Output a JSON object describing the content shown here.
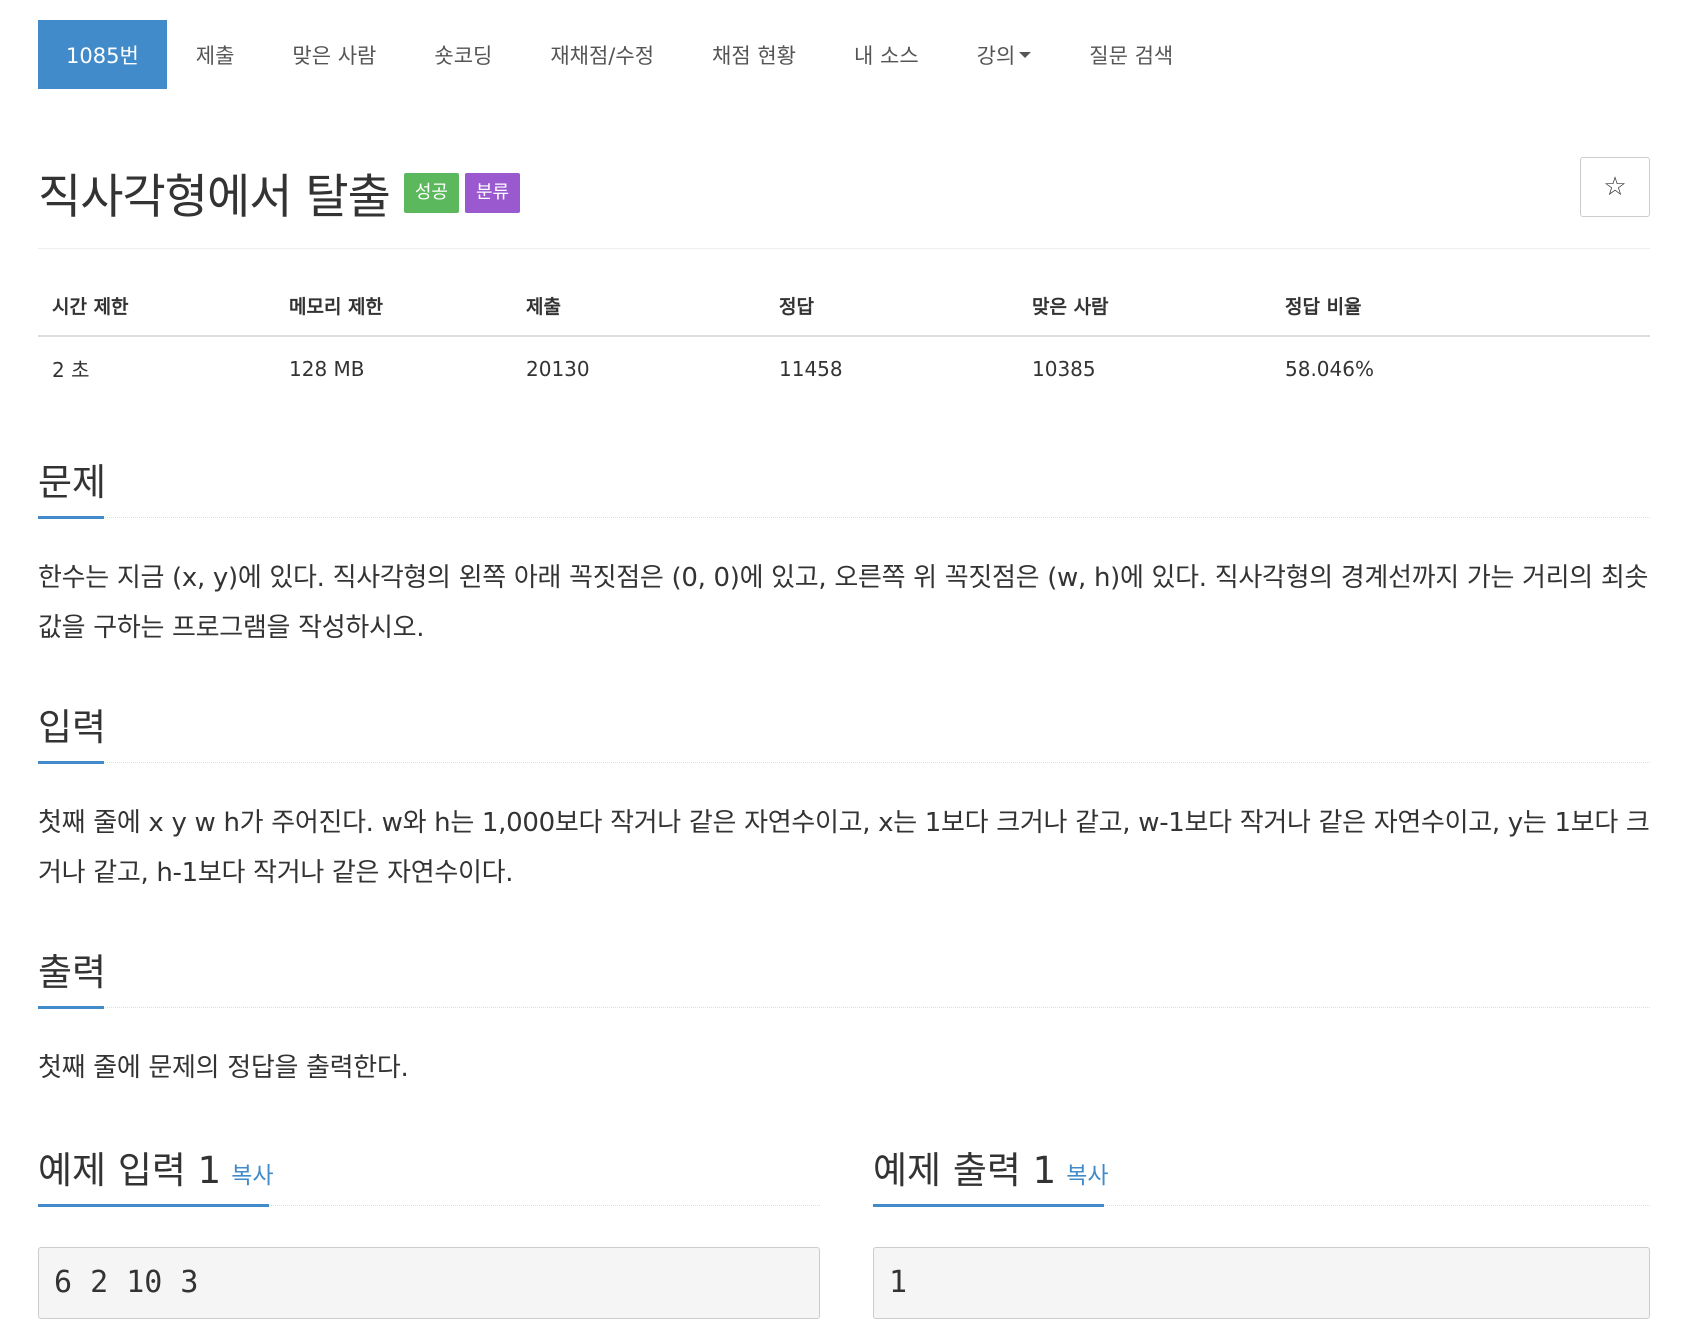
{
  "nav": {
    "items": [
      {
        "label": "1085번",
        "active": true
      },
      {
        "label": "제출"
      },
      {
        "label": "맞은 사람"
      },
      {
        "label": "숏코딩"
      },
      {
        "label": "재채점/수정"
      },
      {
        "label": "채점 현황"
      },
      {
        "label": "내 소스"
      },
      {
        "label": "강의",
        "dropdown": true
      },
      {
        "label": "질문 검색"
      }
    ]
  },
  "problem": {
    "title": "직사각형에서 탈출",
    "badge_success": "성공",
    "badge_tag": "분류",
    "star": "☆"
  },
  "info": {
    "headers": [
      "시간 제한",
      "메모리 제한",
      "제출",
      "정답",
      "맞은 사람",
      "정답 비율"
    ],
    "values": [
      "2 초",
      "128 MB",
      "20130",
      "11458",
      "10385",
      "58.046%"
    ]
  },
  "sections": {
    "description": {
      "title": "문제",
      "text": "한수는 지금 (x, y)에 있다. 직사각형의 왼쪽 아래 꼭짓점은 (0, 0)에 있고, 오른쪽 위 꼭짓점은 (w, h)에 있다. 직사각형의 경계선까지 가는 거리의 최솟값을 구하는 프로그램을 작성하시오."
    },
    "input": {
      "title": "입력",
      "text": "첫째 줄에 x y w h가 주어진다. w와 h는 1,000보다 작거나 같은 자연수이고, x는 1보다 크거나 같고, w-1보다 작거나 같은 자연수이고, y는 1보다 크거나 같고, h-1보다 작거나 같은 자연수이다."
    },
    "output": {
      "title": "출력",
      "text": "첫째 줄에 문제의 정답을 출력한다."
    }
  },
  "samples": {
    "input": {
      "title": "예제 입력 1",
      "copy": "복사",
      "value": "6 2 10 3"
    },
    "output": {
      "title": "예제 출력 1",
      "copy": "복사",
      "value": "1"
    }
  }
}
